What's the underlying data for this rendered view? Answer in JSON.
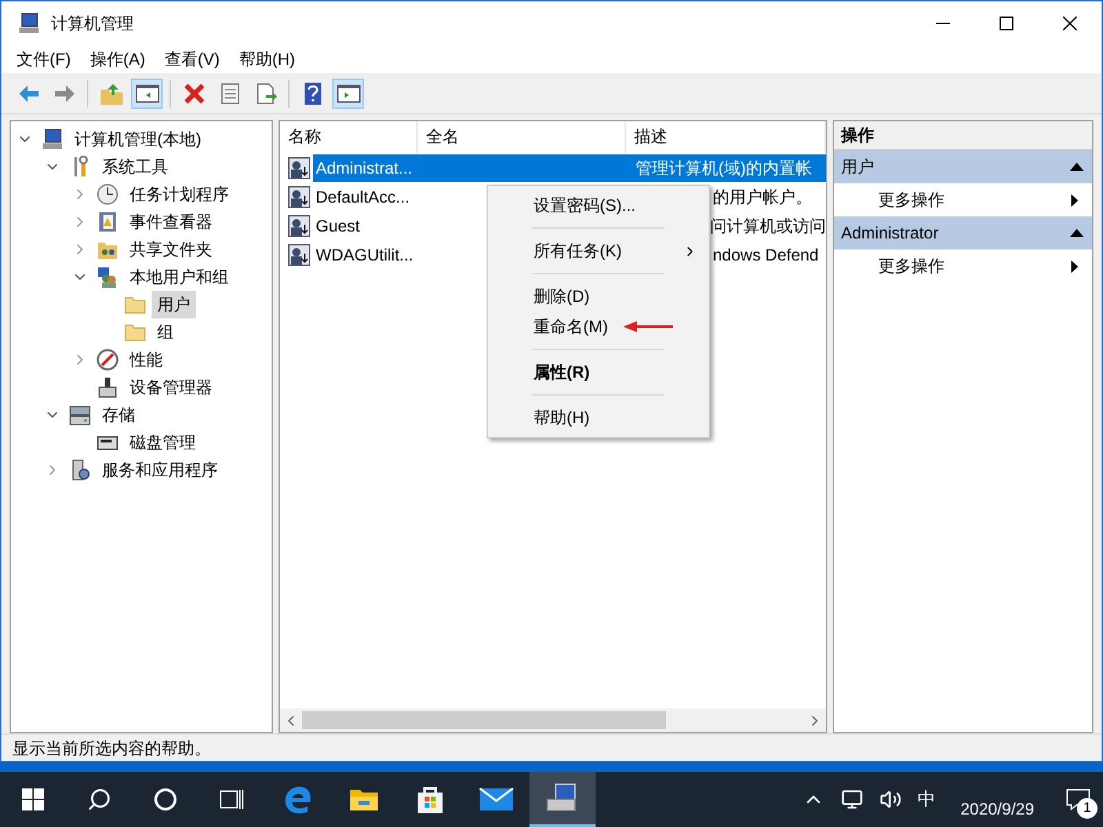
{
  "window": {
    "title": "计算机管理"
  },
  "menu": [
    "文件(F)",
    "操作(A)",
    "查看(V)",
    "帮助(H)"
  ],
  "toolbar": [
    {
      "kind": "back",
      "pressed": false
    },
    {
      "kind": "forward",
      "pressed": false
    },
    {
      "kind": "sep"
    },
    {
      "kind": "up",
      "pressed": false
    },
    {
      "kind": "tree",
      "pressed": true
    },
    {
      "kind": "sep"
    },
    {
      "kind": "delete",
      "pressed": false
    },
    {
      "kind": "properties",
      "pressed": false
    },
    {
      "kind": "export",
      "pressed": false
    },
    {
      "kind": "sep"
    },
    {
      "kind": "help",
      "pressed": false
    },
    {
      "kind": "pane",
      "pressed": true
    }
  ],
  "tree": [
    {
      "label": "计算机管理(本地)",
      "kind": "computer",
      "expanded": true,
      "selected": false,
      "children": [
        {
          "label": "系统工具",
          "kind": "tools",
          "expanded": true,
          "selected": false,
          "children": [
            {
              "label": "任务计划程序",
              "kind": "clock",
              "expanded": false,
              "selected": false
            },
            {
              "label": "事件查看器",
              "kind": "log",
              "expanded": false,
              "selected": false
            },
            {
              "label": "共享文件夹",
              "kind": "share",
              "expanded": false,
              "selected": false
            },
            {
              "label": "本地用户和组",
              "kind": "users",
              "expanded": true,
              "selected": false,
              "children": [
                {
                  "label": "用户",
                  "kind": "folder",
                  "selected": true
                },
                {
                  "label": "组",
                  "kind": "folder",
                  "selected": false
                }
              ]
            },
            {
              "label": "性能",
              "kind": "perf",
              "expanded": false,
              "selected": false
            },
            {
              "label": "设备管理器",
              "kind": "device",
              "selected": false
            }
          ]
        },
        {
          "label": "存储",
          "kind": "storage",
          "expanded": true,
          "selected": false,
          "children": [
            {
              "label": "磁盘管理",
              "kind": "disk",
              "selected": false
            }
          ]
        },
        {
          "label": "服务和应用程序",
          "kind": "services",
          "expanded": false,
          "selected": false
        }
      ]
    }
  ],
  "table": {
    "columns": [
      "名称",
      "全名",
      "描述"
    ],
    "rows": [
      {
        "name": "Administrat...",
        "description": "管理计算机(域)的内置帐",
        "selected": true
      },
      {
        "name": "DefaultAcc...",
        "description": "的用户帐户。",
        "selected": false
      },
      {
        "name": "Guest",
        "description": "问计算机或访问",
        "selected": false
      },
      {
        "name": "WDAGUtilit...",
        "description": "ndows Defend",
        "selected": false
      }
    ]
  },
  "context_menu": [
    {
      "kind": "item",
      "label": "设置密码(S)...",
      "bold": false,
      "submenu": false
    },
    {
      "kind": "sep"
    },
    {
      "kind": "item",
      "label": "所有任务(K)",
      "bold": false,
      "submenu": true
    },
    {
      "kind": "sep"
    },
    {
      "kind": "item",
      "label": "删除(D)",
      "bold": false,
      "submenu": false
    },
    {
      "kind": "item",
      "label": "重命名(M)",
      "bold": false,
      "submenu": false,
      "arrow": true
    },
    {
      "kind": "sep"
    },
    {
      "kind": "item",
      "label": "属性(R)",
      "bold": true,
      "submenu": false
    },
    {
      "kind": "sep"
    },
    {
      "kind": "item",
      "label": "帮助(H)",
      "bold": false,
      "submenu": false
    }
  ],
  "actions": {
    "title": "操作",
    "sections": [
      {
        "title": "用户",
        "items": [
          "更多操作"
        ]
      },
      {
        "title": "Administrator",
        "items": [
          "更多操作"
        ]
      }
    ]
  },
  "status_bar": "显示当前所选内容的帮助。",
  "taskbar": {
    "apps": [
      {
        "kind": "edge",
        "active": false
      },
      {
        "kind": "explorer",
        "active": false
      },
      {
        "kind": "store",
        "active": false
      },
      {
        "kind": "mail",
        "active": false
      },
      {
        "kind": "compmgmt",
        "active": true
      }
    ],
    "ime": "中",
    "date": "2020/9/29",
    "notifications": "1"
  }
}
